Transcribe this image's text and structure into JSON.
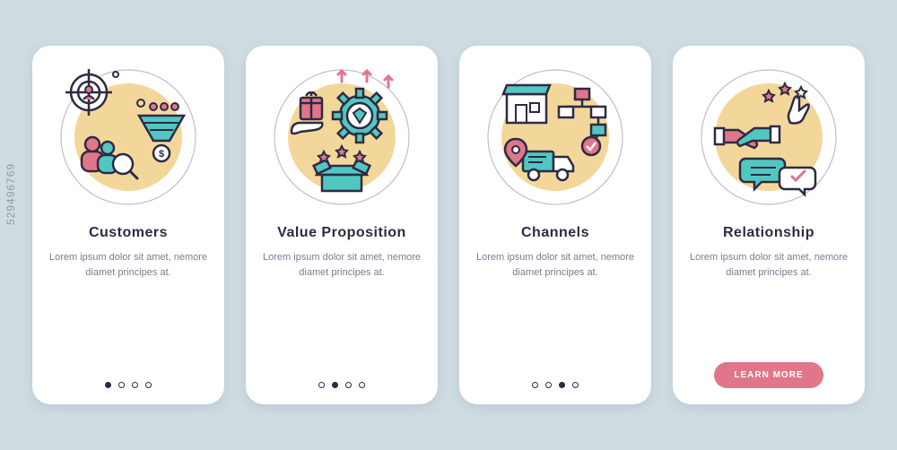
{
  "watermark": "529496769",
  "cards": [
    {
      "title": "Customers",
      "description": "Lorem ipsum dolor sit amet, nemore diamet principes at.",
      "active_dot": 0,
      "has_cta": false
    },
    {
      "title": "Value Proposition",
      "description": "Lorem ipsum dolor sit amet, nemore diamet principes at.",
      "active_dot": 1,
      "has_cta": false
    },
    {
      "title": "Channels",
      "description": "Lorem ipsum dolor sit amet, nemore diamet principes at.",
      "active_dot": 2,
      "has_cta": false
    },
    {
      "title": "Relationship",
      "description": "Lorem ipsum dolor sit amet, nemore diamet principes at.",
      "active_dot": 3,
      "has_cta": true,
      "cta_label": "LEARN MORE"
    }
  ],
  "colors": {
    "bg": "#cfdde3",
    "card": "#ffffff",
    "text_dark": "#2e2a44",
    "text_muted": "#7e7a91",
    "accent_red": "#e1758a",
    "accent_teal": "#52c7c1",
    "accent_yellow": "#f3d79a",
    "stroke": "#2e2a44"
  }
}
